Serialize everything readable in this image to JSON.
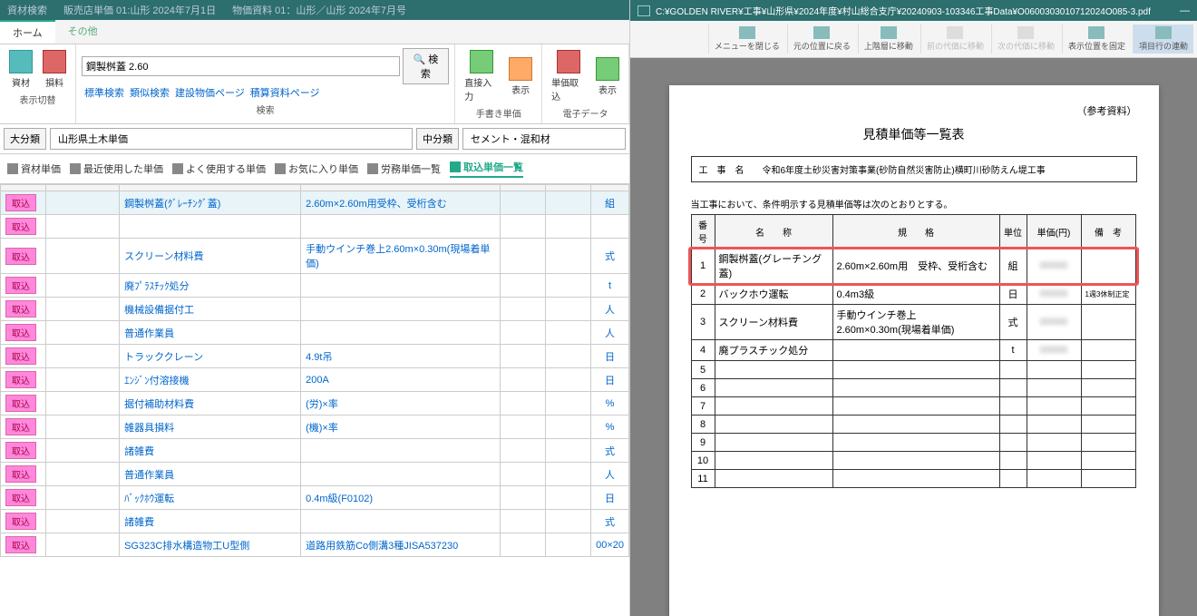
{
  "topbar": {
    "title": "資材検索",
    "info1": "販売店単価 01:山形 2024年7月1日",
    "info2": "物価資料 01：山形／山形 2024年7月号"
  },
  "tabs": {
    "home": "ホーム",
    "other": "その他"
  },
  "ribbon": {
    "mat": "資材",
    "loss": "損料",
    "switch": "表示切替",
    "search_value": "鋼製桝蓋 2.60",
    "search_btn": "検索",
    "std": "標準検索",
    "sim": "類似検索",
    "cpage": "建設物価ページ",
    "epage": "積算資料ページ",
    "search_grp": "検索",
    "direct": "直接入力",
    "show": "表示",
    "handwrite": "手書き単価",
    "take": "単価取込",
    "show2": "表示",
    "edata": "電子データ"
  },
  "cat": {
    "l1": "大分類",
    "v1": "山形県土木単価",
    "l2": "中分類",
    "v2": "セメント・混和材"
  },
  "nav": {
    "t1": "資材単価",
    "t2": "最近使用した単価",
    "t3": "よく使用する単価",
    "t4": "お気に入り単価",
    "t5": "労務単価一覧",
    "t6": "取込単価一覧"
  },
  "rows": [
    {
      "name": "鋼製桝蓋(ｸﾞﾚｰﾁﾝｸﾞ蓋)",
      "spec": "2.60m×2.60m用受枠、受桁含む",
      "unit": "組",
      "hl": true
    },
    {
      "name": "",
      "spec": "",
      "unit": ""
    },
    {
      "name": "スクリーン材料費",
      "spec": "手動ウインチ巻上2.60m×0.30m(現場着単価)",
      "unit": "式"
    },
    {
      "name": "廃ﾌﾟﾗｽﾁｯｸ処分",
      "spec": "",
      "unit": "t"
    },
    {
      "name": "機械設備据付工",
      "spec": "",
      "unit": "人"
    },
    {
      "name": "普通作業員",
      "spec": "",
      "unit": "人"
    },
    {
      "name": "トラッククレーン",
      "spec": "4.9t吊",
      "unit": "日"
    },
    {
      "name": "ｴﾝｼﾞﾝ付溶接機",
      "spec": "200A",
      "unit": "日"
    },
    {
      "name": "据付補助材料費",
      "spec": "(労)×率",
      "unit": "%"
    },
    {
      "name": "雑器具損料",
      "spec": "(機)×率",
      "unit": "%"
    },
    {
      "name": "諸雑費",
      "spec": "",
      "unit": "式"
    },
    {
      "name": "普通作業員",
      "spec": "",
      "unit": "人"
    },
    {
      "name": "ﾊﾞｯｸﾎｳ運転",
      "spec": "0.4m級(F0102)",
      "unit": "日"
    },
    {
      "name": "諸雑費",
      "spec": "",
      "unit": "式"
    },
    {
      "name": "SG323C排水構造物工U型側",
      "spec": "道路用鉄筋Co側溝3種JISA537230",
      "unit": "00×20"
    }
  ],
  "take": "取込",
  "pdf": {
    "path": "C:¥GOLDEN RIVER¥工事¥山形県¥2024年度¥村山総合支庁¥20240903-103346工事Data¥O0600303010712024O085-3.pdf",
    "tools": {
      "close": "メニューを閉じる",
      "back": "元の位置に戻る",
      "up": "上階層に移動",
      "prev": "前の代価に移動",
      "next": "次の代価に移動",
      "fix": "表示位置を固定",
      "link": "項目行の連動"
    },
    "ref": "（参考資料）",
    "doc_title": "見積単価等一覧表",
    "proj_label": "工　事　名",
    "proj_name": "令和6年度土砂災害対策事業(砂防自然災害防止)横町川砂防えん堤工事",
    "note": "当工事において、条件明示する見積単価等は次のとおりとする。",
    "hdr": {
      "no": "番号",
      "name": "名　　称",
      "spec": "規　　格",
      "unit": "単位",
      "price": "単価(円)",
      "remark": "備　考"
    },
    "items": [
      {
        "no": "1",
        "name": "鋼製桝蓋(グレーチング蓋)",
        "spec": "2.60m×2.60m用　受枠、受桁含む",
        "unit": "組",
        "hl": true
      },
      {
        "no": "2",
        "name": "バックホウ運転",
        "spec": "0.4m3級",
        "unit": "日",
        "rem": "1週3休制正定"
      },
      {
        "no": "3",
        "name": "スクリーン材料費",
        "spec": "手動ウインチ巻上　2.60m×0.30m(現場着単価)",
        "unit": "式"
      },
      {
        "no": "4",
        "name": "廃プラスチック処分",
        "spec": "",
        "unit": "t"
      },
      {
        "no": "5",
        "name": "",
        "spec": "",
        "unit": ""
      },
      {
        "no": "6",
        "name": "",
        "spec": "",
        "unit": ""
      },
      {
        "no": "7",
        "name": "",
        "spec": "",
        "unit": ""
      },
      {
        "no": "8",
        "name": "",
        "spec": "",
        "unit": ""
      },
      {
        "no": "9",
        "name": "",
        "spec": "",
        "unit": ""
      },
      {
        "no": "10",
        "name": "",
        "spec": "",
        "unit": ""
      },
      {
        "no": "11",
        "name": "",
        "spec": "",
        "unit": ""
      }
    ]
  }
}
